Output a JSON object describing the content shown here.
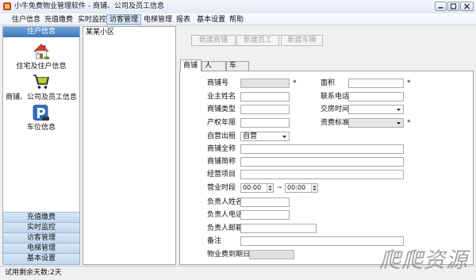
{
  "window": {
    "title": "小牛免费物业管理软件 - 商铺、公司及员工信息"
  },
  "menu": [
    {
      "label": "住户信息"
    },
    {
      "label": "充值缴费"
    },
    {
      "label": "实时监控"
    },
    {
      "label": "访客管理",
      "highlighted": true
    },
    {
      "label": "电梯管理"
    },
    {
      "label": "报表"
    },
    {
      "label": "基本设置"
    },
    {
      "label": "帮助"
    }
  ],
  "sidebar": {
    "header": "住户信息",
    "items": [
      {
        "label": "住宅及住户信息",
        "icon": "house-icon"
      },
      {
        "label": "商铺、公司及员工信息",
        "icon": "shopping-cart-icon"
      },
      {
        "label": "车位信息",
        "icon": "parking-icon"
      }
    ],
    "bottom": [
      {
        "label": "充值缴费"
      },
      {
        "label": "实时监控"
      },
      {
        "label": "访客管理"
      },
      {
        "label": "电梯管理"
      },
      {
        "label": "基本设置"
      }
    ]
  },
  "tree": {
    "root": "某某小区"
  },
  "toolbar": {
    "new_shop": "新建商铺",
    "new_staff": "新建员工",
    "new_vehicle": "新建车辆"
  },
  "tabs": [
    {
      "label": "商铺"
    },
    {
      "label": "人"
    },
    {
      "label": "车"
    }
  ],
  "form": {
    "shop_no": {
      "label": "商铺号",
      "value": "",
      "required": "*"
    },
    "area": {
      "label": "面积",
      "value": "",
      "required": "*"
    },
    "owner_name": {
      "label": "业主姓名",
      "value": ""
    },
    "contact_phone": {
      "label": "联系电话",
      "value": ""
    },
    "shop_type": {
      "label": "商铺类型",
      "value": ""
    },
    "handover_time": {
      "label": "交房时间",
      "value": ""
    },
    "property_years": {
      "label": "产权年限",
      "value": ""
    },
    "fee_standard": {
      "label": "资费标准",
      "value": "",
      "required": "*"
    },
    "operation_mode": {
      "label": "自营出租",
      "value": "自营"
    },
    "full_name": {
      "label": "商铺全称",
      "value": ""
    },
    "short_name": {
      "label": "商铺简称",
      "value": ""
    },
    "business_scope": {
      "label": "经营项目",
      "value": ""
    },
    "business_hours": {
      "label": "营业时段",
      "start": "00:00",
      "separator": "~",
      "end": "00:00"
    },
    "manager_name": {
      "label": "负责人姓名",
      "value": ""
    },
    "manager_phone": {
      "label": "负责人电话",
      "value": ""
    },
    "manager_email": {
      "label": "负责人邮箱",
      "value": ""
    },
    "remark": {
      "label": "备注",
      "value": ""
    },
    "fee_expiry": {
      "label": "物业费到期日",
      "value": ""
    }
  },
  "status": {
    "text": "试用剩余天数:2天"
  },
  "watermark": "爬爬资源",
  "colors": {
    "sidebar_header": "#3c76ba",
    "sidebar_buttons": "#c9ddf1",
    "menu_highlight": "#d7e7f8",
    "disabled_text": "#a3a3a3"
  }
}
